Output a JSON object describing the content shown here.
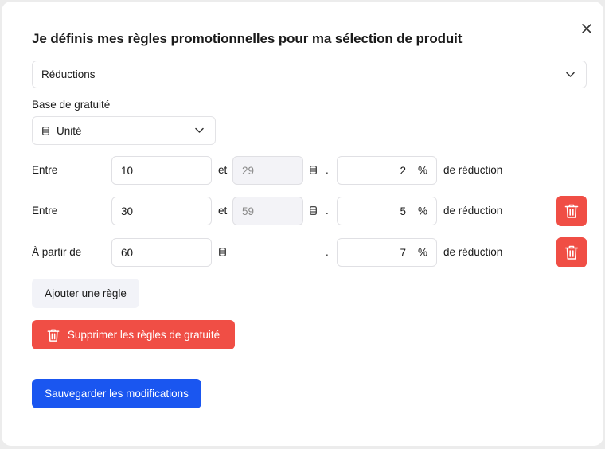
{
  "modal": {
    "title": "Je définis mes règles promotionnelles pour ma sélection de produit",
    "rule_type": "Réductions",
    "base_label": "Base de gratuité",
    "base_value": "Unité"
  },
  "rules": [
    {
      "label": "Entre",
      "from": "10",
      "joiner": "et",
      "to": "29",
      "sep": ".",
      "value": "2",
      "unit": "%",
      "suffix": "de réduction"
    },
    {
      "label": "Entre",
      "from": "30",
      "joiner": "et",
      "to": "59",
      "sep": ".",
      "value": "5",
      "unit": "%",
      "suffix": "de réduction"
    },
    {
      "label": "À partir de",
      "from": "60",
      "sep": ".",
      "value": "7",
      "unit": "%",
      "suffix": "de réduction"
    }
  ],
  "buttons": {
    "add_rule": "Ajouter une règle",
    "delete_rules": "Supprimer les règles de gratuité",
    "save": "Sauvegarder les modifications"
  },
  "colors": {
    "primary": "#1a56f0",
    "danger": "#f04e45",
    "secondary_bg": "#f2f3f8"
  }
}
